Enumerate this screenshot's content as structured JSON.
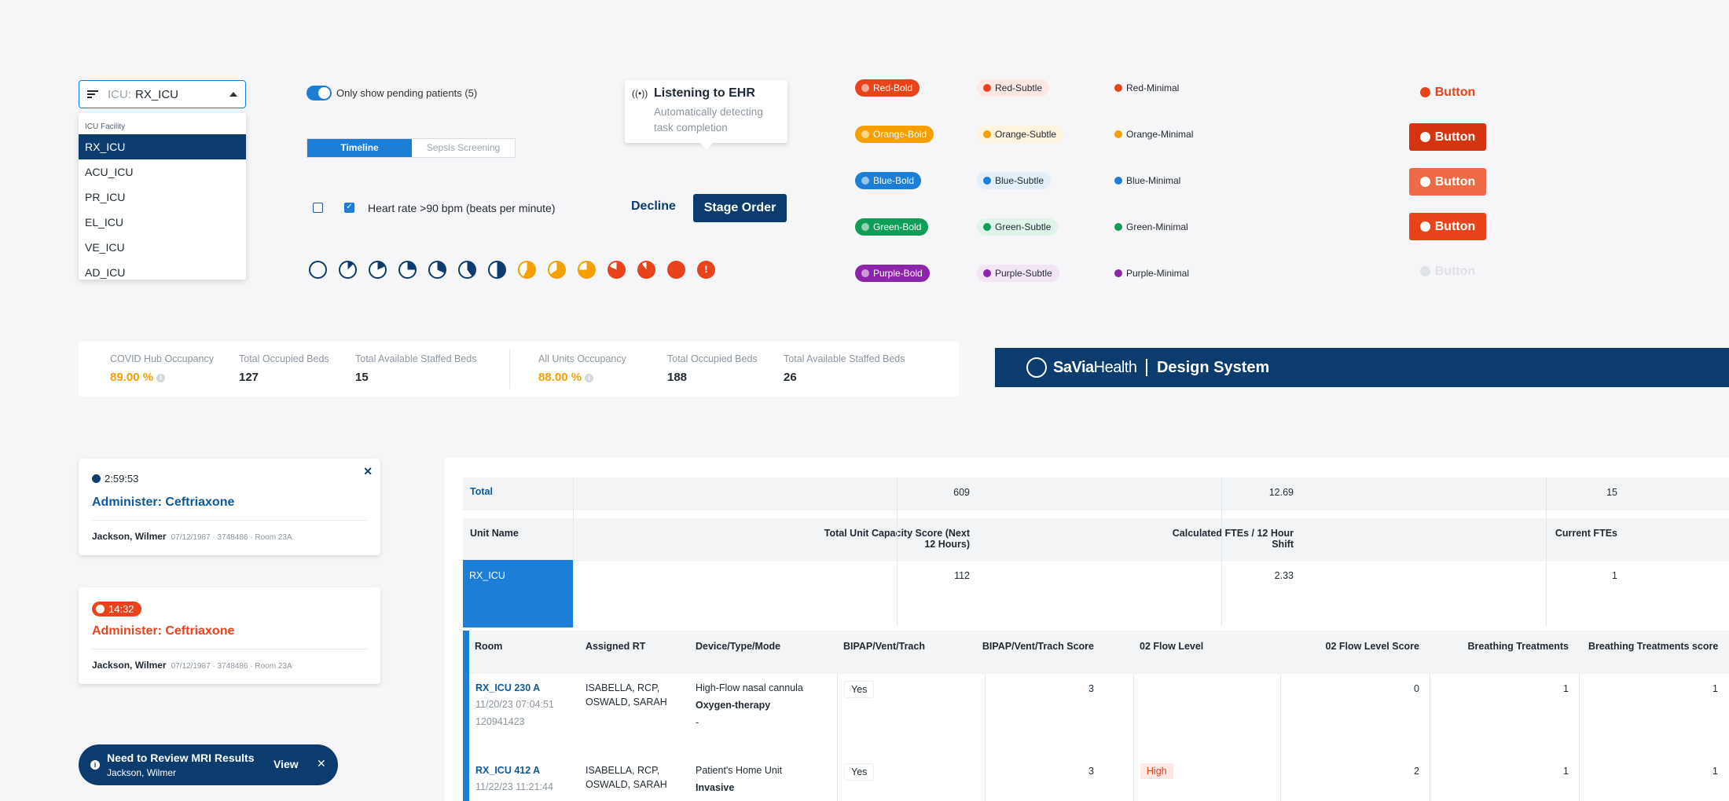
{
  "dropdown": {
    "prefix": "ICU:",
    "value": "RX_ICU",
    "header": "ICU Facility",
    "options": [
      "RX_ICU",
      "ACU_ICU",
      "PR_ICU",
      "EL_ICU",
      "VE_ICU",
      "AD_ICU"
    ]
  },
  "toggle": {
    "label": "Only show pending patients (5)"
  },
  "tabs": {
    "active": "Timeline",
    "inactive": "Sepsis Screening"
  },
  "checkbox": {
    "label": "Heart rate >90 bpm (beats per minute)"
  },
  "actions": {
    "decline": "Decline",
    "stage": "Stage Order"
  },
  "listening": {
    "title": "Listening to EHR",
    "subtitle": "Automatically detecting task completion"
  },
  "badges": {
    "bold": [
      "Red-Bold",
      "Orange-Bold",
      "Blue-Bold",
      "Green-Bold",
      "Purple-Bold"
    ],
    "subtle": [
      "Red-Subtle",
      "Orange-Subtle",
      "Blue-Subtle",
      "Green-Subtle",
      "Purple-Subtle"
    ],
    "minimal": [
      "Red-Minimal",
      "Orange-Minimal",
      "Blue-Minimal",
      "Green-Minimal",
      "Purple-Minimal"
    ]
  },
  "colors": {
    "red": "#e8431a",
    "orange": "#f59f00",
    "blue": "#1c7ed6",
    "green": "#0f9d58",
    "purple": "#8e24aa",
    "navy": "#0c3c6e"
  },
  "buttons": [
    "Button",
    "Button",
    "Button",
    "Button",
    "Button"
  ],
  "stats_left": {
    "covid_label": "COVID Hub Occupancy",
    "covid_value": "89.00 %",
    "occ_label": "Total Occupied Beds",
    "occ_value": "127",
    "avail_label": "Total Available Staffed Beds",
    "avail_value": "15"
  },
  "stats_right": {
    "all_label": "All Units Occupancy",
    "all_value": "88.00 %",
    "occ_label": "Total Occupied Beds",
    "occ_value": "188",
    "avail_label": "Total Available Staffed Beds",
    "avail_value": "26"
  },
  "banner": {
    "brand_bold": "SaVia",
    "brand_rest": "Health",
    "title": "Design System"
  },
  "tasks": [
    {
      "time": "2:59:53",
      "title": "Administer: Ceftriaxone",
      "patient": "Jackson, Wilmer",
      "meta": "07/12/1987 · 3748486 · Room 23A"
    },
    {
      "time": "14:32",
      "title": "Administer: Ceftriaxone",
      "patient": "Jackson, Wilmer",
      "meta": "07/12/1987 · 3748486 · Room 23A"
    }
  ],
  "toast": {
    "title": "Need to Review MRI Results",
    "subtitle": "Jackson, Wilmer",
    "action": "View"
  },
  "summary": {
    "total_label": "Total",
    "total_capacity": "609",
    "total_ftes": "12.69",
    "total_current": "15",
    "col_unit": "Unit Name",
    "col_capacity": "Total Unit Capacity Score (Next 12 Hours)",
    "col_fte": "Calculated FTEs / 12 Hour Shift",
    "col_current": "Current FTEs",
    "unit": "RX_ICU",
    "unit_capacity": "112",
    "unit_fte": "2.33",
    "unit_current": "1"
  },
  "detail_headers": [
    "Room",
    "Assigned RT",
    "Device/Type/Mode",
    "BIPAP/Vent/Trach",
    "BIPAP/Vent/Trach Score",
    "02 Flow Level",
    "02 Flow Level Score",
    "Breathing Treatments",
    "Breathing Treatments score"
  ],
  "detail_rows": [
    {
      "room": "RX_ICU 230 A",
      "date": "11/20/23 07:04:51",
      "id": "120941423",
      "rt1": "ISABELLA, RCP,",
      "rt2": "OSWALD, SARAH",
      "device": "High-Flow nasal cannula",
      "type": "Oxygen-therapy",
      "mode": "-",
      "bipap": "Yes",
      "bipap_score": "3",
      "flow": "",
      "flow_score": "0",
      "bt": "1",
      "bt_score": "1"
    },
    {
      "room": "RX_ICU 412 A",
      "date": "11/22/23 11:21:44",
      "id": "",
      "rt1": "ISABELLA, RCP,",
      "rt2": "OSWALD, SARAH",
      "device": "Patient's Home Unit",
      "type": "Invasive",
      "mode": "",
      "bipap": "Yes",
      "bipap_score": "3",
      "flow": "High",
      "flow_score": "2",
      "bt": "1",
      "bt_score": "1"
    }
  ]
}
